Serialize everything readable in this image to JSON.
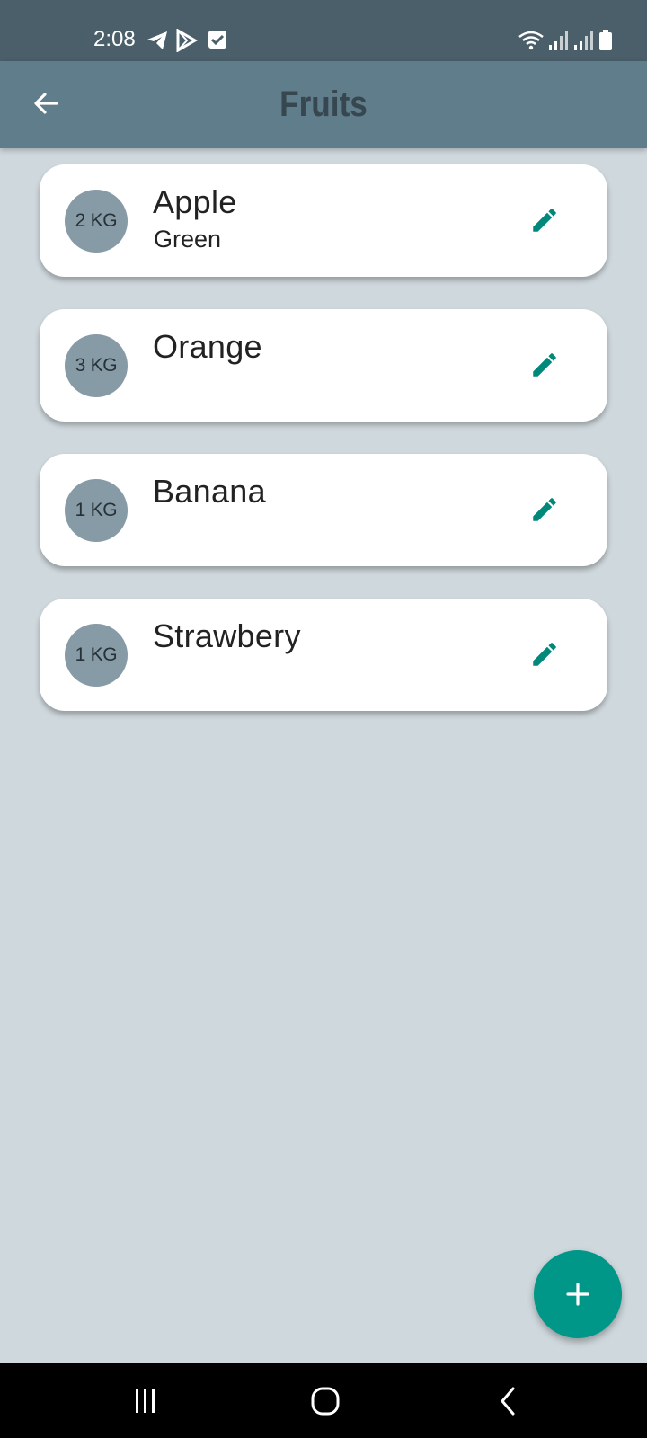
{
  "status_bar": {
    "time": "2:08",
    "icons": [
      "telegram-icon",
      "play-store-icon",
      "checkbox-icon",
      "wifi-icon",
      "signal-icon",
      "signal-icon",
      "battery-icon"
    ]
  },
  "app_bar": {
    "title": "Fruits",
    "back_icon": "arrow-back-icon"
  },
  "fruits": [
    {
      "name": "Apple",
      "subtitle": "Green",
      "weight": "2 KG"
    },
    {
      "name": "Orange",
      "subtitle": "",
      "weight": "3 KG"
    },
    {
      "name": "Banana",
      "subtitle": "",
      "weight": "1 KG"
    },
    {
      "name": "Strawbery",
      "subtitle": "",
      "weight": "1 KG"
    }
  ],
  "fab": {
    "icon": "plus-icon"
  },
  "nav_bar": {
    "icons": [
      "recents-icon",
      "home-icon",
      "back-icon"
    ]
  },
  "colors": {
    "status_bar": "#4b5f6b",
    "app_bar": "#607d8b",
    "title": "#37474f",
    "background": "#cfd8dd",
    "badge": "#879ba6",
    "accent": "#009688"
  }
}
